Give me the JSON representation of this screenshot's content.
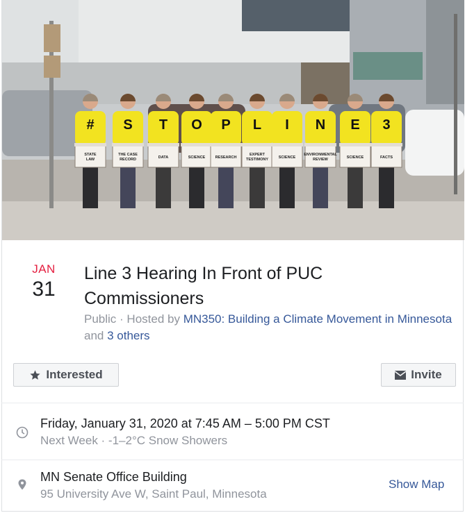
{
  "photo": {
    "box_labels": [
      "STATE LAW",
      "THE CASE RECORD",
      "DATA",
      "SCIENCE",
      "RESEARCH",
      "EXPERT TESTIMONY",
      "SCIENCE",
      "ENVIRONMENTAL REVIEW",
      "SCIENCE",
      "FACTS"
    ],
    "shirt_letters": [
      "#",
      "S",
      "T",
      "O",
      "P",
      "L",
      "I",
      "N",
      "E",
      "3"
    ]
  },
  "event": {
    "month": "JAN",
    "day": "31",
    "title": "Line 3 Hearing In Front of PUC Commissioners",
    "privacy": "Public",
    "hosted_by_prefix": " · Hosted by ",
    "host": "MN350: Building a Climate Movement in Minnesota",
    "and_text": " and ",
    "others": "3 others"
  },
  "actions": {
    "interested_label": "Interested",
    "invite_label": "Invite"
  },
  "details": {
    "datetime": "Friday, January 31, 2020 at 7:45 AM – 5:00 PM CST",
    "weather": "Next Week · -1–2°C Snow Showers",
    "location_name": "MN Senate Office Building",
    "address": "95 University Ave W, Saint Paul, Minnesota",
    "show_map_label": "Show Map"
  },
  "colors": {
    "month_red": "#e41e3f",
    "link_blue": "#365899",
    "shirt_yellow": "#f2e320",
    "muted_gray": "#90949c"
  }
}
